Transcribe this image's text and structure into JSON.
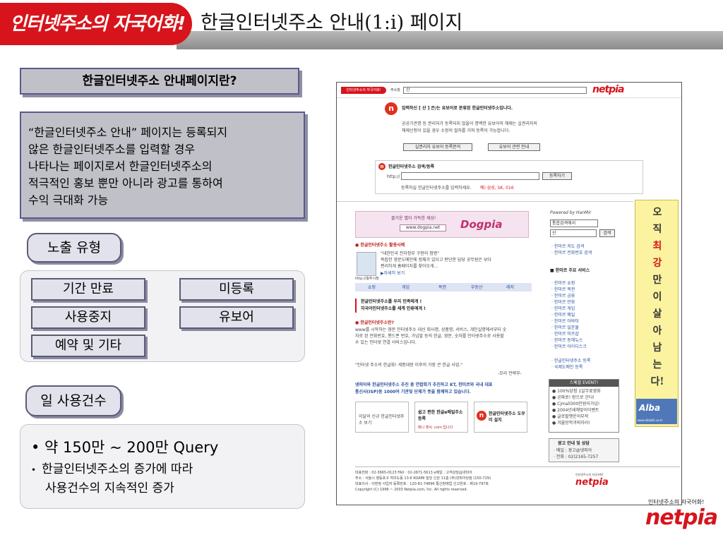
{
  "header": {
    "logo_text": "인터넷주소의 자국어화!",
    "title": "한글인터넷주소 안내(1:i) 페이지"
  },
  "intro": {
    "question": "한글인터넷주소 안내페이지란?",
    "description_lines": [
      "“한글인터넷주소 안내” 페이지는 등록되지",
      "않은 한글인터넷주소를 입력할 경우",
      "나타나는 페이지로서 한글인터넷주소의",
      "적극적인 홍보 뿐만 아니라 광고를 통하여",
      "수익 극대화 가능"
    ]
  },
  "exposure": {
    "label": "노출 유형",
    "types": [
      "기간 만료",
      "미등록",
      "사용중지",
      "유보어",
      "예약 및 기타"
    ]
  },
  "usage": {
    "label": "일 사용건수",
    "main": "• 약 150만 ~ 200만 Query",
    "sub_bullet": "•",
    "sub_line1": "한글인터넷주소의 증가에 따라",
    "sub_line2": "사용건수의 지속적인 증가"
  },
  "screenshot": {
    "logo_small": "인터넷주소의 자국어화!",
    "address_label": "주소창",
    "address_value": "산",
    "netpia": "netpia",
    "notice_title": "입력하신 [ 산 ] 은/는 유보어로 분류된 한글인터넷주소입니다.",
    "notice_body_1": "공공기관명 등 권리자가 등록되지 않을이 명백한 유보어의 해제는 실권리자의",
    "notice_body_2": "해제신청이 있을 경우 소정의 절차를 거쳐 등록이 가능합니다.",
    "btn_apply": "실권리자 유보어 등록문의",
    "btn_info": "유보어 관련 안내",
    "search_title": "한글인터넷주소 검색/등록",
    "search_prefix": "http://",
    "search_btn": "등록하기",
    "search_hint": "등록하실 한글인터넷주소를 입력하세요.",
    "search_example": "예) 삼성, SK, 016",
    "dog_text": "즐거운 별이 가득한 세상!",
    "dog_url": "www.dogpia.net",
    "dogpia": "Dogpia",
    "case_title": "● 한글인터넷주소 활용사례",
    "case_body_1": "\"대한민국 전자정부 구현의 첨병\"",
    "case_body_2": "복잡한 영문도메인에 정체가 있다고 판단한 담당 공무원은 보다",
    "case_body_3": "편리하게 홈페이지를 찾아오게...",
    "case_link": "▶자세히 보기",
    "case_label": "http://충주시청",
    "tabs": [
      "쇼핑",
      "게임",
      "복권",
      "부동산",
      "레저"
    ],
    "slogan_1": "한글인터넷주소를 우리 민족에게 !",
    "slogan_2": "자국어인터넷주소를 세계 인류에게 !",
    "what_title": "● 한글인터넷주소란?",
    "what_body_1": "www를 시작하는 영문 인터넷주소 대신 회사명, 상품명, 서비스, 개인실명에서부터 숫",
    "what_body_2": "자로 된 전화번호, 핸드폰 번호, 가넘말 등의 한글, 영문, 숫자를 인터넷주소로 사용할",
    "what_body_3": "수 있는 인터넷 연결 서비스입니다.",
    "quote": "\"인터넷 주소의 한글화! 세종대왕 이후의 가장 큰 한글 사업.\"",
    "quote_src": "-모리 전략부-",
    "partner_1": "넷피아와 한글인터넷주소 추진 총 연합회가 추진하고 KT, 한미르와 국내 대표",
    "partner_2": "통신사(ISP)등 1000여 기관및 단체가 뜻을 함께하고 있습니다.",
    "svc_1": "이달의 신규 한글인터넷주소 보기",
    "svc_2": "쉽고 편한 한글e메일주소 등록",
    "svc_2b": "매니 엔씨 .com 입니다",
    "svc_3": "한글인터넷주소 도우미 설치",
    "powered": "Powered by HanMir",
    "right_select": "통합검색에서",
    "right_input": "산",
    "right_btn": "검색",
    "right_link_1": "· 한미르 지도 검색",
    "right_link_2": "· 한미르 전화번호 검색",
    "right_svc_title": "■ 한미르 주요 서비스",
    "right_svcs": [
      "· 한미르 쇼핑",
      "· 한미르 복권",
      "· 한미르 금융",
      "· 한미르 만화",
      "· 한미르 게임",
      "· 한미르 메일",
      "· 한미르 아바타",
      "· 한미르 일본물",
      "· 한미르 미르샵",
      "· 한미르 동해뉴스",
      "· 한미르 아이디스크"
    ],
    "right_link_3": "· 한글인터넷주소 등록",
    "right_link_4": "· 국제도메인 등록",
    "event_title": "스페셜 EVENT!",
    "events": [
      "● 100%당첨 1일무료영화",
      "● 공짜로! 랑으로 간다!",
      "● Cjmall300만원이가넘!",
      "● 2004년새해맞이이벤트",
      "● 글로팔행운의부적",
      "● 겨울방학과외자리!"
    ],
    "ad_title": "광고 안내 및 상담",
    "ad_mail": "· 메일 : 광고@넷피아",
    "ad_phone": "· 전화 : 02)2165-7257",
    "banner_chars": [
      "오",
      "직",
      "최",
      "강",
      "만",
      "이",
      "살",
      "아",
      "남",
      "는",
      "다!"
    ],
    "alba": "Alba",
    "alba_url": "www.alba82.co.kr",
    "footer_1": "대표전화 : 02-3665-0123  FAX : 02-2671-5613  e메일 : 고객상담@넷피아",
    "footer_2": "주소 : 서울시 영등포구 여의도동 13-6 KOAMI 빌딩 신관 11층 (주)넷피아닷컴 (150-729)",
    "footer_3": "대표이사 : 이판정  사업자 등록번호 : 120-81-74896  통신판매업 신고번호 : 제19-797호",
    "footer_4": "Copyright (C) 1996 ~ 2003 Netpia.com, Inc. All rights reserved.",
    "footer_logo_caption": "인터넷주소의 자국어화!",
    "footer_logo": "netpia"
  },
  "brand": {
    "caption": "인터넷주소의 자국어화!",
    "logo": "netpia"
  },
  "colors": {
    "accent_red": "#d7141c",
    "box_gray": "#c0c0c8",
    "pill_fill": "#e2e2ec",
    "banner_yellow": "#fbf3a0"
  }
}
